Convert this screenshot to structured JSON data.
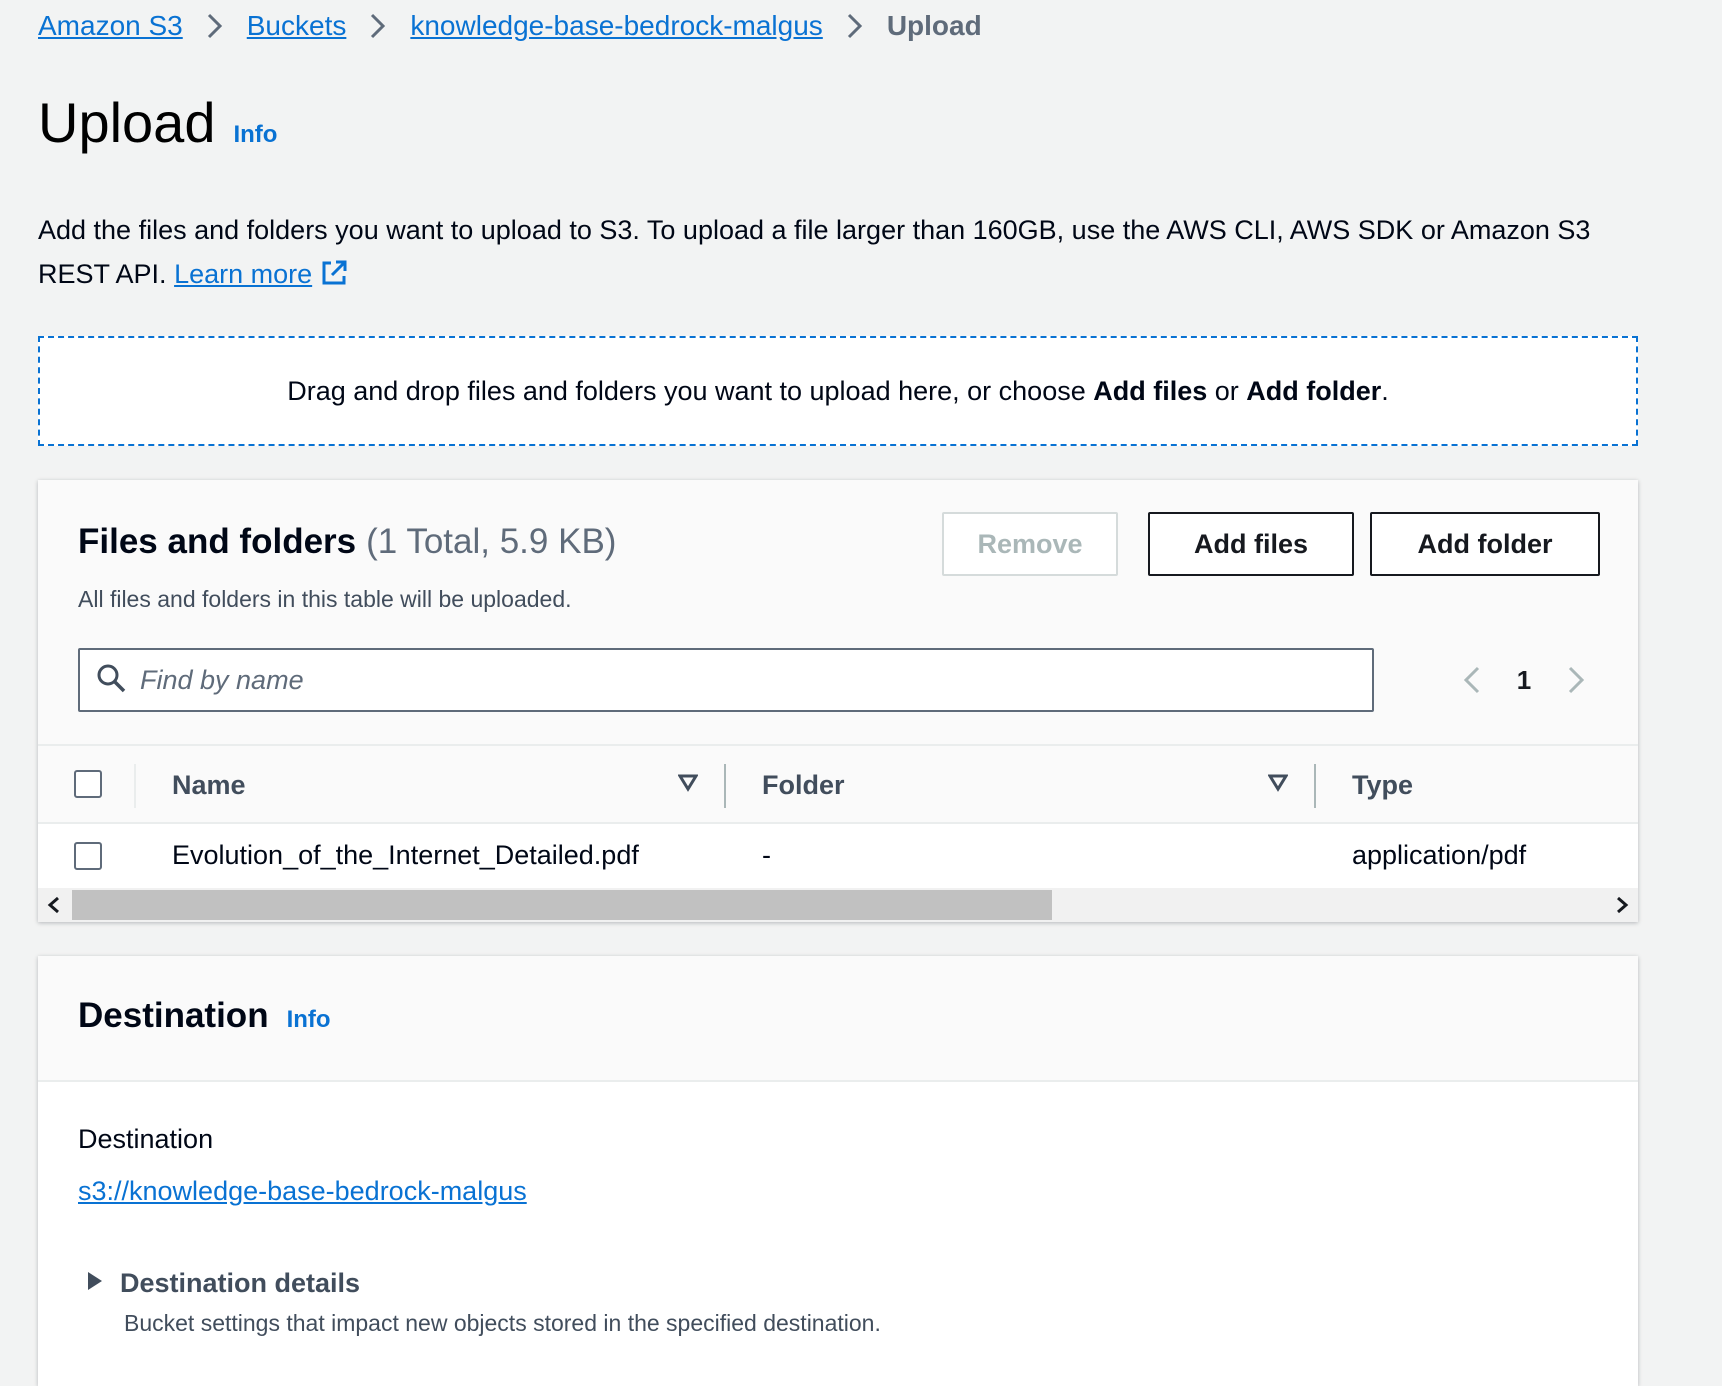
{
  "breadcrumb": {
    "items": [
      "Amazon S3",
      "Buckets",
      "knowledge-base-bedrock-malgus"
    ],
    "current": "Upload"
  },
  "page": {
    "title": "Upload",
    "info_label": "Info",
    "description": "Add the files and folders you want to upload to S3. To upload a file larger than 160GB, use the AWS CLI, AWS SDK or Amazon S3 REST API.",
    "learn_more": "Learn more"
  },
  "dropzone": {
    "prefix": "Drag and drop files and folders you want to upload here, or choose ",
    "add_files": "Add files",
    "or": " or ",
    "add_folder": "Add folder",
    "suffix": "."
  },
  "files_panel": {
    "title": "Files and folders",
    "count": "(1 Total, 5.9 KB)",
    "subtitle": "All files and folders in this table will be uploaded.",
    "buttons": {
      "remove": "Remove",
      "add_files": "Add files",
      "add_folder": "Add folder"
    },
    "search_placeholder": "Find by name",
    "page_number": "1",
    "columns": [
      "Name",
      "Folder",
      "Type"
    ],
    "rows": [
      {
        "name": "Evolution_of_the_Internet_Detailed.pdf",
        "folder": "-",
        "type": "application/pdf"
      }
    ],
    "scroll_thumb_fraction": 0.64
  },
  "destination_panel": {
    "title": "Destination",
    "info_label": "Info",
    "label": "Destination",
    "value": "s3://knowledge-base-bedrock-malgus",
    "details_label": "Destination details",
    "details_description": "Bucket settings that impact new objects stored in the specified destination."
  },
  "colors": {
    "link": "#0972d3",
    "background": "#f2f3f3",
    "text": "#000716",
    "secondary_text": "#5f6b7a",
    "disabled": "#aab7b8"
  }
}
